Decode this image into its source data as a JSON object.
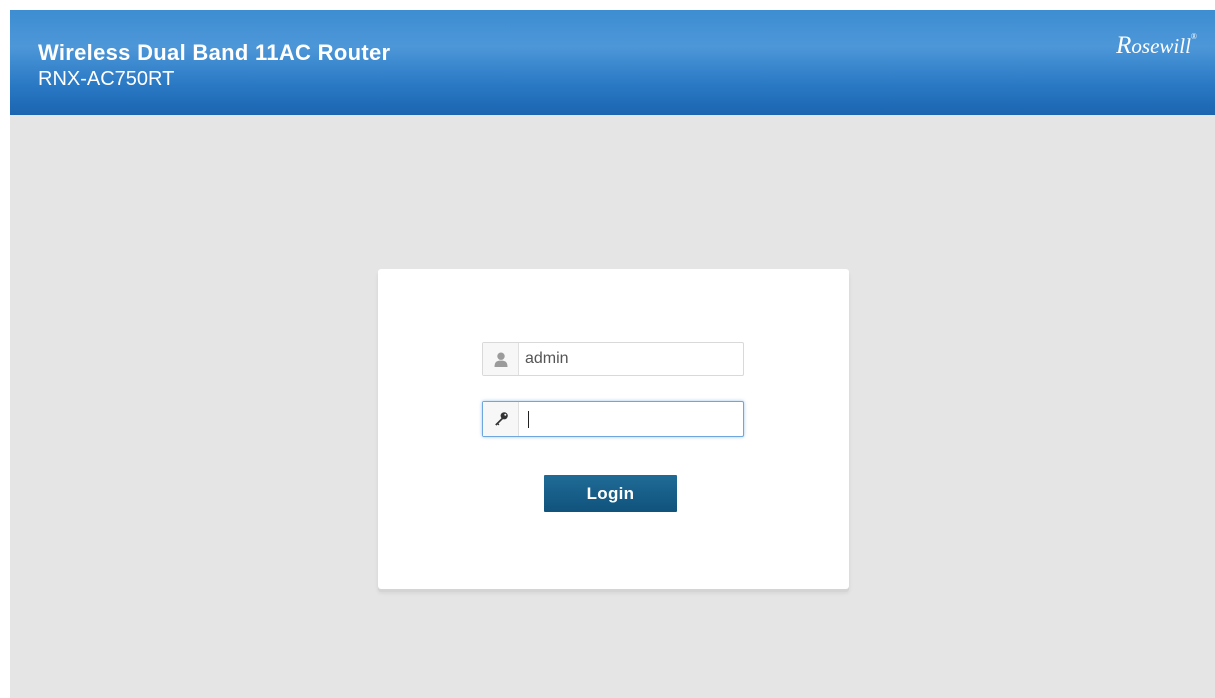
{
  "header": {
    "title": "Wireless Dual Band 11AC Router",
    "model": "RNX-AC750RT",
    "brand": "Rosewill",
    "brand_initial": "R",
    "brand_rest": "osewill",
    "brand_mark": "®"
  },
  "login": {
    "username": {
      "value": "admin",
      "icon": "user-icon"
    },
    "password": {
      "value": "",
      "icon": "key-icon"
    },
    "button_label": "Login"
  },
  "colors": {
    "header_blue": "#2b7ac5",
    "button_blue": "#10537c",
    "background": "#e5e5e5"
  }
}
